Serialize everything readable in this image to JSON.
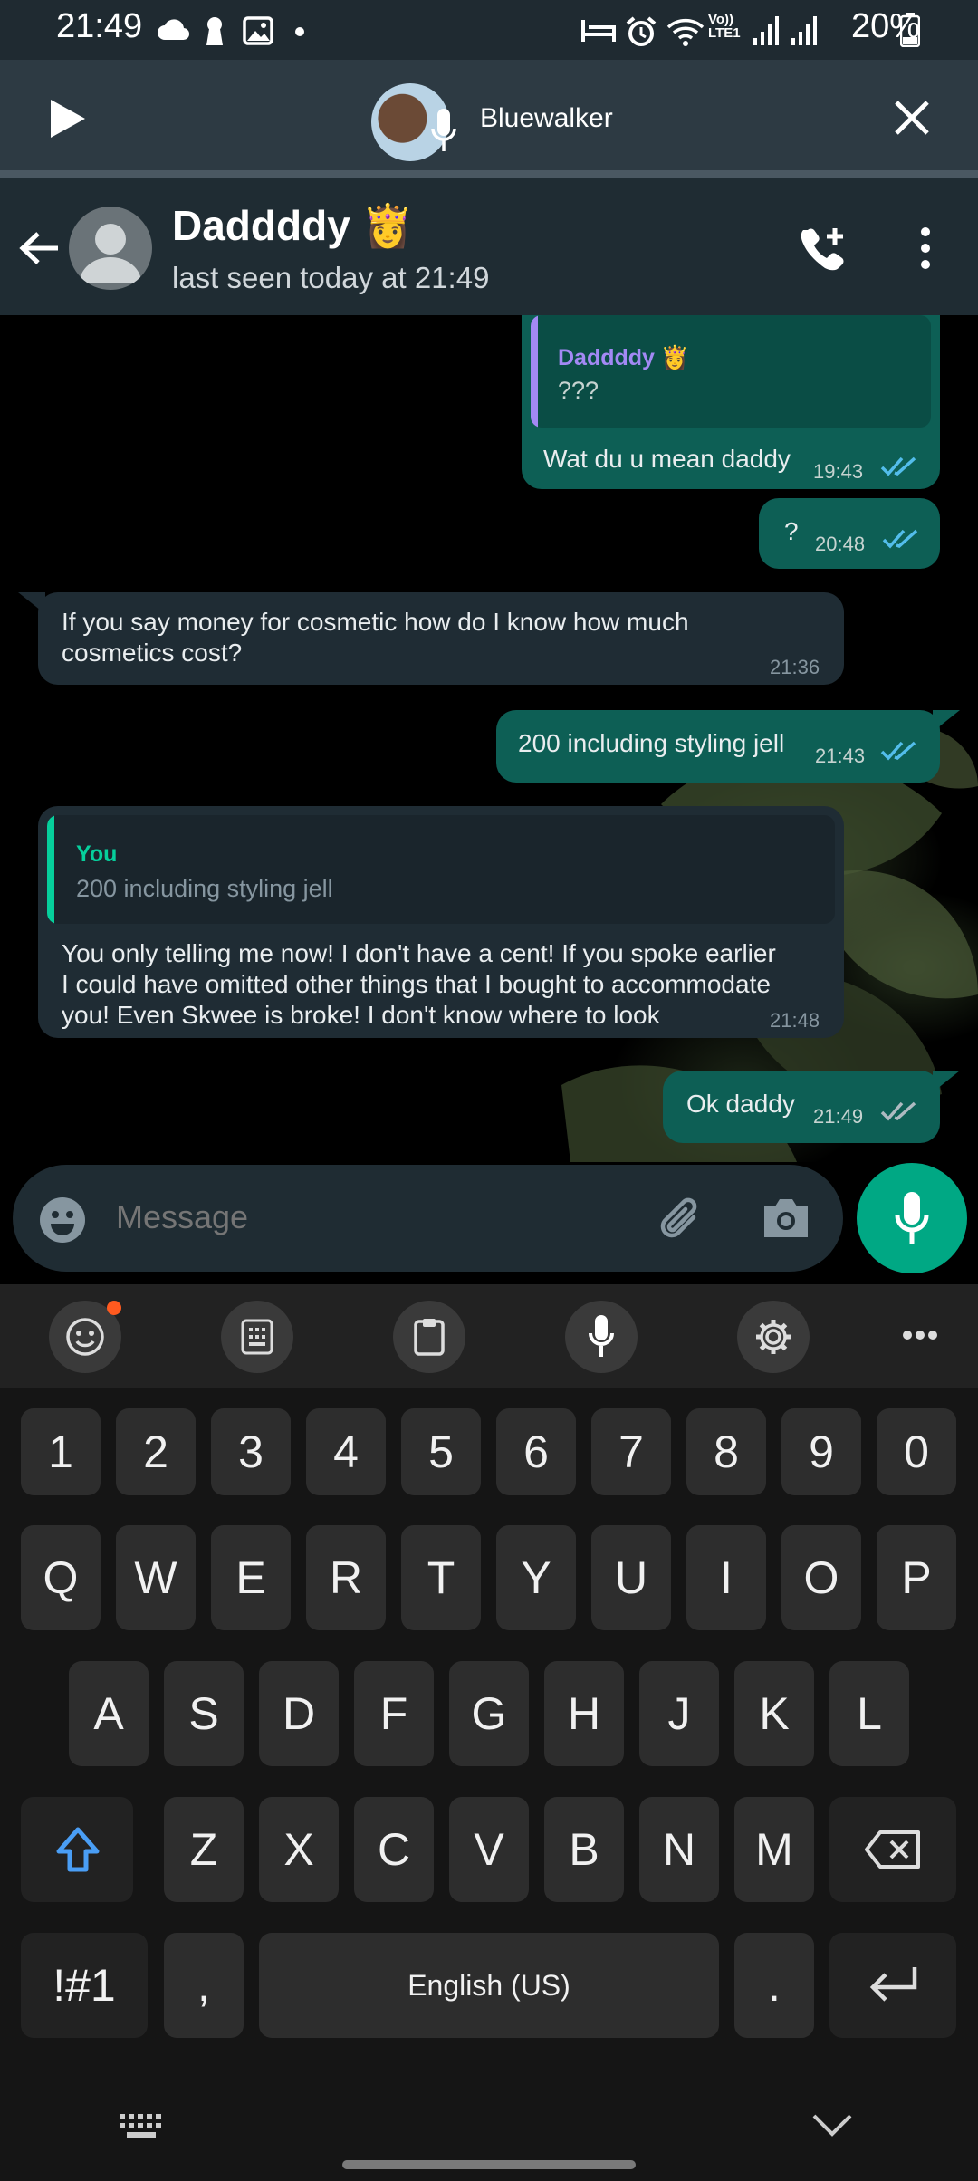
{
  "status_bar": {
    "time": "21:49",
    "battery": "20%"
  },
  "voice_banner": {
    "title": "Bluewalker"
  },
  "header": {
    "name": "Daddddy 👸",
    "status": "last seen today at 21:49"
  },
  "messages": [
    {
      "direction": "out",
      "quote_name": "Daddddy 👸",
      "quote_text": "???",
      "text": "Wat du u mean daddy",
      "time": "19:43"
    },
    {
      "direction": "out",
      "text": "?",
      "time": "20:48"
    },
    {
      "direction": "in",
      "text_line1": "If you say money for cosmetic how do I know how much",
      "text_line2": "cosmetics cost?",
      "time": "21:36"
    },
    {
      "direction": "out",
      "text": "200 including styling jell",
      "time": "21:43"
    },
    {
      "direction": "in",
      "quote_name": "You",
      "quote_text": "200 including styling jell",
      "text_line1": "You only telling me now! I don't have a cent! If you spoke earlier",
      "text_line2": "I could have omitted other things that I bought to accommodate",
      "text_line3": "you! Even Skwee is broke! I don't know where to look",
      "time": "21:48"
    },
    {
      "direction": "out",
      "text": "Ok daddy",
      "time": "21:49"
    }
  ],
  "composer": {
    "placeholder": "Message"
  },
  "keyboard": {
    "row_numbers": [
      "1",
      "2",
      "3",
      "4",
      "5",
      "6",
      "7",
      "8",
      "9",
      "0"
    ],
    "row_q": [
      "Q",
      "W",
      "E",
      "R",
      "T",
      "Y",
      "U",
      "I",
      "O",
      "P"
    ],
    "row_a": [
      "A",
      "S",
      "D",
      "F",
      "G",
      "H",
      "J",
      "K",
      "L"
    ],
    "row_z": [
      "Z",
      "X",
      "C",
      "V",
      "B",
      "N",
      "M"
    ],
    "symbols_key": "!#1",
    "comma_key": ",",
    "space_key": "English (US)",
    "period_key": "."
  },
  "colors": {
    "accent": "#00a884",
    "outgoing_bubble": "#0d5f55",
    "incoming_bubble": "#1f2c34",
    "read_ticks": "#53bdeb"
  }
}
